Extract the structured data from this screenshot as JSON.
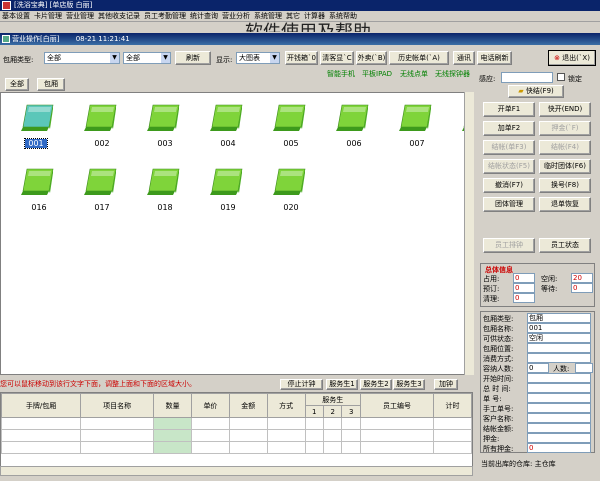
{
  "app_title": "[洗浴宝典] [单店版 白丽]",
  "menu": [
    "基本设置",
    "卡片管理",
    "营业管理",
    "其他收支记录",
    "员工考勤管理",
    "统计查询",
    "营业分析",
    "系统管理",
    "其它",
    "计算器",
    "系统帮助"
  ],
  "background_title": "软件使用及帮助",
  "window": {
    "title": "营业操作[白丽]",
    "time": "08-21 11:21:41"
  },
  "toolbar": {
    "room_type_label": "包厢类型:",
    "room_type_value": "全部",
    "second_value": "全部",
    "refresh": "刷新",
    "display_label": "显示:",
    "display_value": "大图表",
    "buttons": [
      "开钱箱`0",
      "清客显`C",
      "外卖(`B)",
      "历史帐单(`A)",
      "通讯",
      "电话刷新"
    ],
    "exit": "退出(`X)",
    "green_links": [
      "智能手机",
      "平板IPAD",
      "无线点单",
      "无线探钟器"
    ]
  },
  "tabs": [
    "全部",
    "包厢"
  ],
  "rooms": [
    {
      "num": "001",
      "selected": true
    },
    {
      "num": "002"
    },
    {
      "num": "003"
    },
    {
      "num": "004"
    },
    {
      "num": "005"
    },
    {
      "num": "006"
    },
    {
      "num": "007"
    },
    {
      "num": "0"
    },
    {
      "num": "016"
    },
    {
      "num": "017"
    },
    {
      "num": "018"
    },
    {
      "num": "019"
    },
    {
      "num": "020"
    }
  ],
  "hint": "您可以鼠标移动到该行文字下面，调整上面和下面的区域大小。",
  "grid_buttons": [
    "停止计钟",
    "服务生1",
    "服务生2",
    "服务生3",
    "加钟"
  ],
  "grid_headers": [
    "手牌/包厢",
    "项目名称",
    "数量",
    "单价",
    "金额",
    "方式",
    "服务生",
    "员工编号",
    "计时"
  ],
  "grid_subheaders": [
    "1",
    "2",
    "3"
  ],
  "right": {
    "sense_label": "感应:",
    "lock": "锁定",
    "quick": "快结(F9)",
    "buttons": [
      {
        "label": "开单F1",
        "dis": false
      },
      {
        "label": "快开(END)",
        "dis": false
      },
      {
        "label": "加单F2",
        "dis": false
      },
      {
        "label": "押金(`F)",
        "dis": true
      },
      {
        "label": "结帐(单F3)",
        "dis": true
      },
      {
        "label": "结帐(F4)",
        "dis": true
      },
      {
        "label": "结帐状态(F5)",
        "dis": true
      },
      {
        "label": "临时团体(F6)",
        "dis": false
      },
      {
        "label": "撤消(F7)",
        "dis": false
      },
      {
        "label": "换号(F8)",
        "dis": false
      },
      {
        "label": "团体管理",
        "dis": false
      },
      {
        "label": "退单恢复",
        "dis": false
      },
      {
        "label": "员工排钟",
        "dis": true
      },
      {
        "label": "员工状态",
        "dis": false
      }
    ],
    "summary_title": "总体信息",
    "summary": [
      {
        "k": "占用:",
        "v": "0"
      },
      {
        "k": "空闲:",
        "v": "20"
      },
      {
        "k": "预订:",
        "v": "0"
      },
      {
        "k": "等待:",
        "v": "0"
      },
      {
        "k": "清理:",
        "v": "0"
      }
    ],
    "details": [
      {
        "k": "包厢类型:",
        "v": "包厢"
      },
      {
        "k": "包厢名称:",
        "v": "001"
      },
      {
        "k": "可供状态:",
        "v": "空闲"
      },
      {
        "k": "包厢位置:",
        "v": ""
      },
      {
        "k": "消费方式:",
        "v": ""
      },
      {
        "k": "容纳人数:",
        "v": "0"
      },
      {
        "k": "开始时间:",
        "v": ""
      },
      {
        "k": "总 时 间:",
        "v": ""
      },
      {
        "k": "单    号:",
        "v": ""
      },
      {
        "k": "手工单号:",
        "v": ""
      },
      {
        "k": "客户名称:",
        "v": ""
      },
      {
        "k": "结帐金额:",
        "v": ""
      },
      {
        "k": "押金:",
        "v": ""
      },
      {
        "k": "所有押金:",
        "v": "0"
      }
    ],
    "people_label": "人数:",
    "warehouse": "当前出库的仓库: 主仓库"
  },
  "colors": {
    "tile_green": "#7fd43a",
    "tile_teal": "#5bc7b9",
    "title_blue": "#0a246a",
    "accent_red": "#cc0000"
  }
}
